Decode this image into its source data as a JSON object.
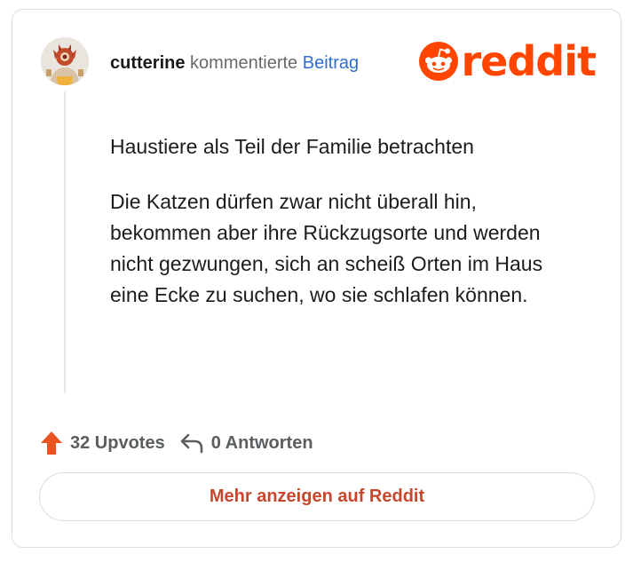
{
  "comment": {
    "username": "cutterine",
    "action_text": "kommentierte",
    "post_link_label": "Beitrag",
    "paragraphs": [
      "Haustiere als Teil der Familie betrachten",
      "Die Katzen dürfen zwar nicht überall hin, bekommen aber ihre Rückzugsorte und werden nicht gezwungen, sich an scheiß Orten im Haus eine Ecke zu suchen, wo sie schlafen können."
    ]
  },
  "brand": {
    "name": "reddit",
    "color": "#ff4500"
  },
  "stats": {
    "upvotes_label": "32 Upvotes",
    "replies_label": "0 Antworten",
    "upvote_icon": "upvote-arrow-icon",
    "reply_icon": "reply-arrow-icon"
  },
  "actions": {
    "more_label": "Mehr anzeigen auf Reddit"
  },
  "colors": {
    "accent": "#ff4500",
    "link": "#2f6fd0",
    "button_text": "#c7472d"
  }
}
